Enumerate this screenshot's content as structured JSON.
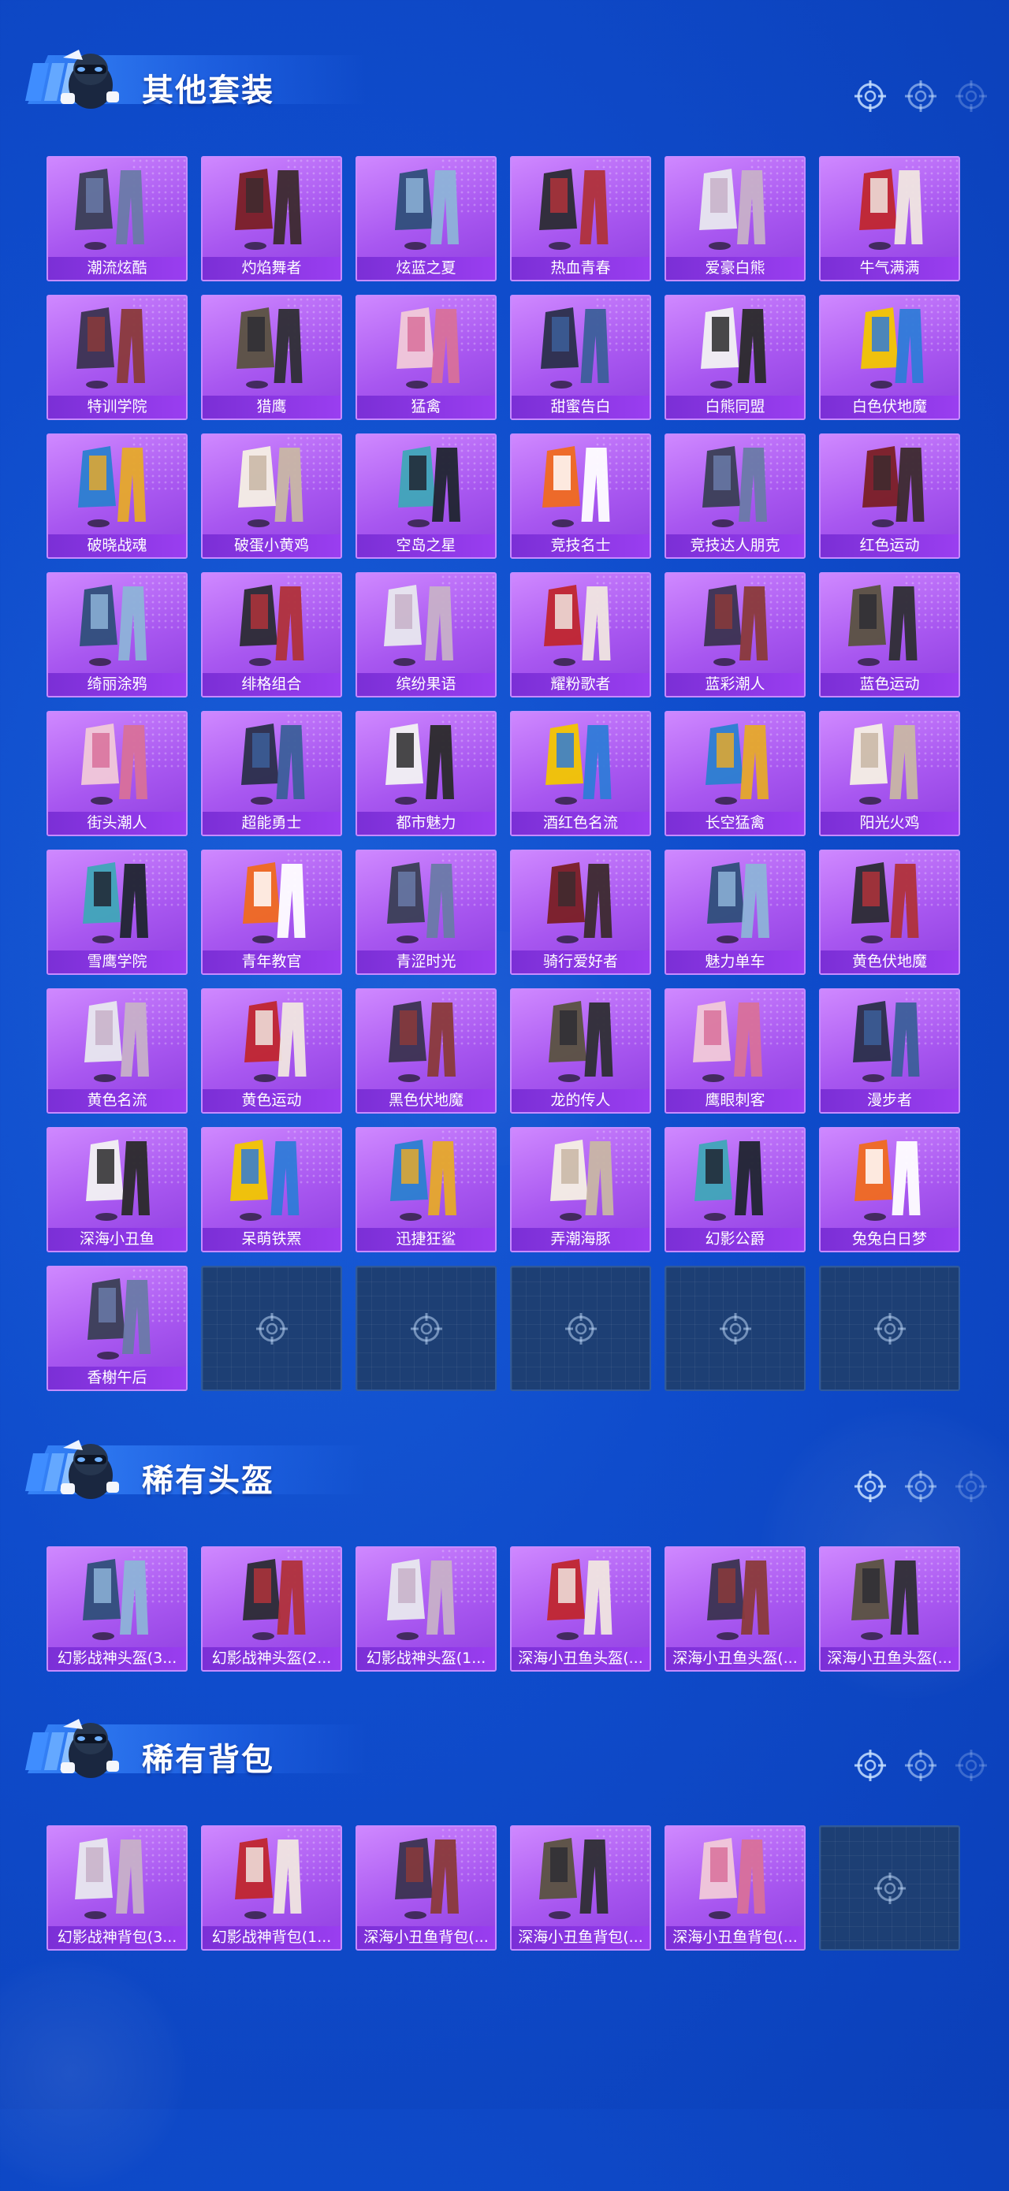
{
  "colors": {
    "background": "#0f4ccc",
    "card_purple": "#a857f0",
    "label_purple": "#7b2fd6",
    "empty_slot": "#1d3f74"
  },
  "sections": [
    {
      "title": "其他套装",
      "items": [
        "潮流炫酷",
        "灼焰舞者",
        "炫蓝之夏",
        "热血青春",
        "爱豪白熊",
        "牛气满满",
        "特训学院",
        "猎鹰",
        "猛禽",
        "甜蜜告白",
        "白熊同盟",
        "白色伏地魔",
        "破晓战魂",
        "破蛋小黄鸡",
        "空岛之星",
        "竞技名士",
        "竞技达人朋克",
        "红色运动",
        "绮丽涂鸦",
        "绯格组合",
        "缤纷果语",
        "耀粉歌者",
        "蓝彩潮人",
        "蓝色运动",
        "街头潮人",
        "超能勇士",
        "都市魅力",
        "酒红色名流",
        "长空猛禽",
        "阳光火鸡",
        "雪鹰学院",
        "青年教官",
        "青涩时光",
        "骑行爱好者",
        "魅力单车",
        "黄色伏地魔",
        "黄色名流",
        "黄色运动",
        "黑色伏地魔",
        "龙的传人",
        "鹰眼刺客",
        "漫步者",
        "深海小丑鱼",
        "呆萌铁罴",
        "迅捷狂鲨",
        "弄潮海豚",
        "幻影公爵",
        "兔兔白日梦",
        "香榭午后"
      ],
      "empty_slots": 5
    },
    {
      "title": "稀有头盔",
      "items": [
        "幻影战神头盔(3...",
        "幻影战神头盔(2...",
        "幻影战神头盔(1...",
        "深海小丑鱼头盔(...",
        "深海小丑鱼头盔(...",
        "深海小丑鱼头盔(..."
      ],
      "empty_slots": 0
    },
    {
      "title": "稀有背包",
      "items": [
        "幻影战神背包(3...",
        "幻影战神背包(1...",
        "深海小丑鱼背包(...",
        "深海小丑鱼背包(...",
        "深海小丑鱼背包(..."
      ],
      "empty_slots": 1
    }
  ],
  "icons": {
    "header_mascot": "soldier-mascot-icon",
    "target": "crosshair-target-icon"
  }
}
